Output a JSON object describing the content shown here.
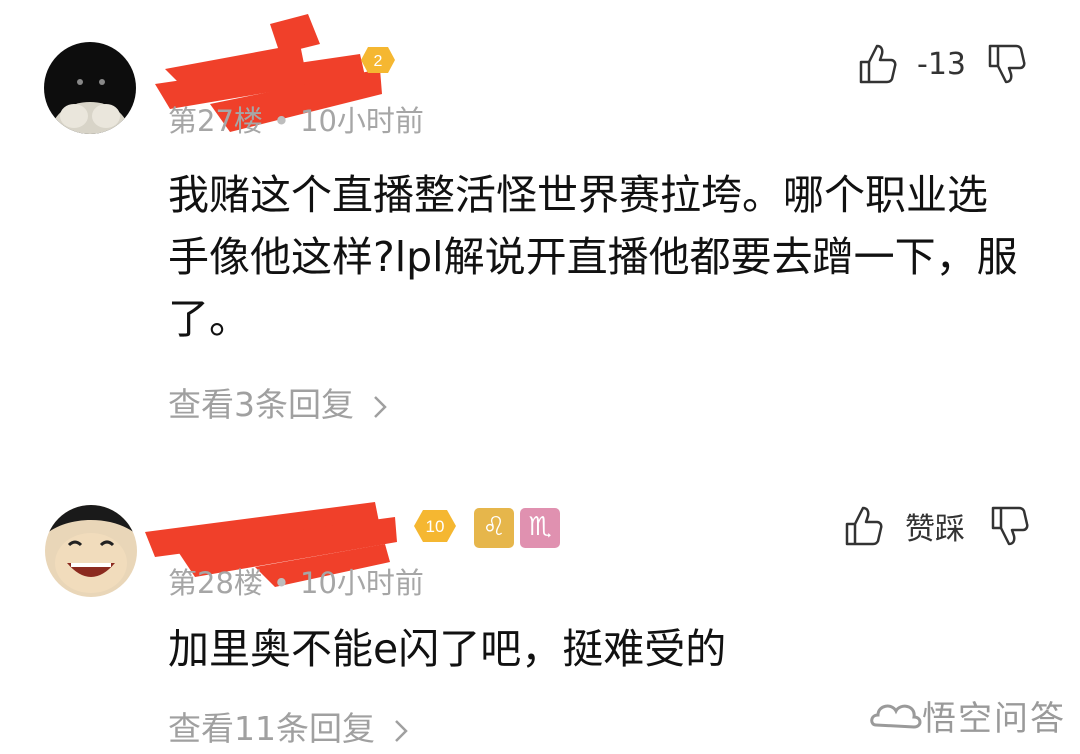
{
  "comments": [
    {
      "level": "2",
      "floor": "第27楼",
      "time": "10小时前",
      "text": "我赌这个直播整活怪世界赛拉垮。哪个职业选手像他这样?lpl解说开直播他都要去蹭一下，服了。",
      "vote_label": "-13",
      "replies": "查看3条回复"
    },
    {
      "level": "10",
      "floor": "第28楼",
      "time": "10小时前",
      "text": "加里奥不能e闪了吧，挺难受的",
      "vote_label": "赞踩",
      "replies": "查看11条回复",
      "zodiac_tags": [
        "♌",
        "♏"
      ]
    }
  ],
  "watermark": {
    "text": "悟空问答",
    "icon": "wukong-cloud-icon"
  },
  "colors": {
    "redaction": "#f0402a",
    "badge": "#f5b731",
    "meta": "#a6a6a6",
    "leo_tag": "#e6b64b",
    "scorpio_tag": "#e091b0"
  }
}
